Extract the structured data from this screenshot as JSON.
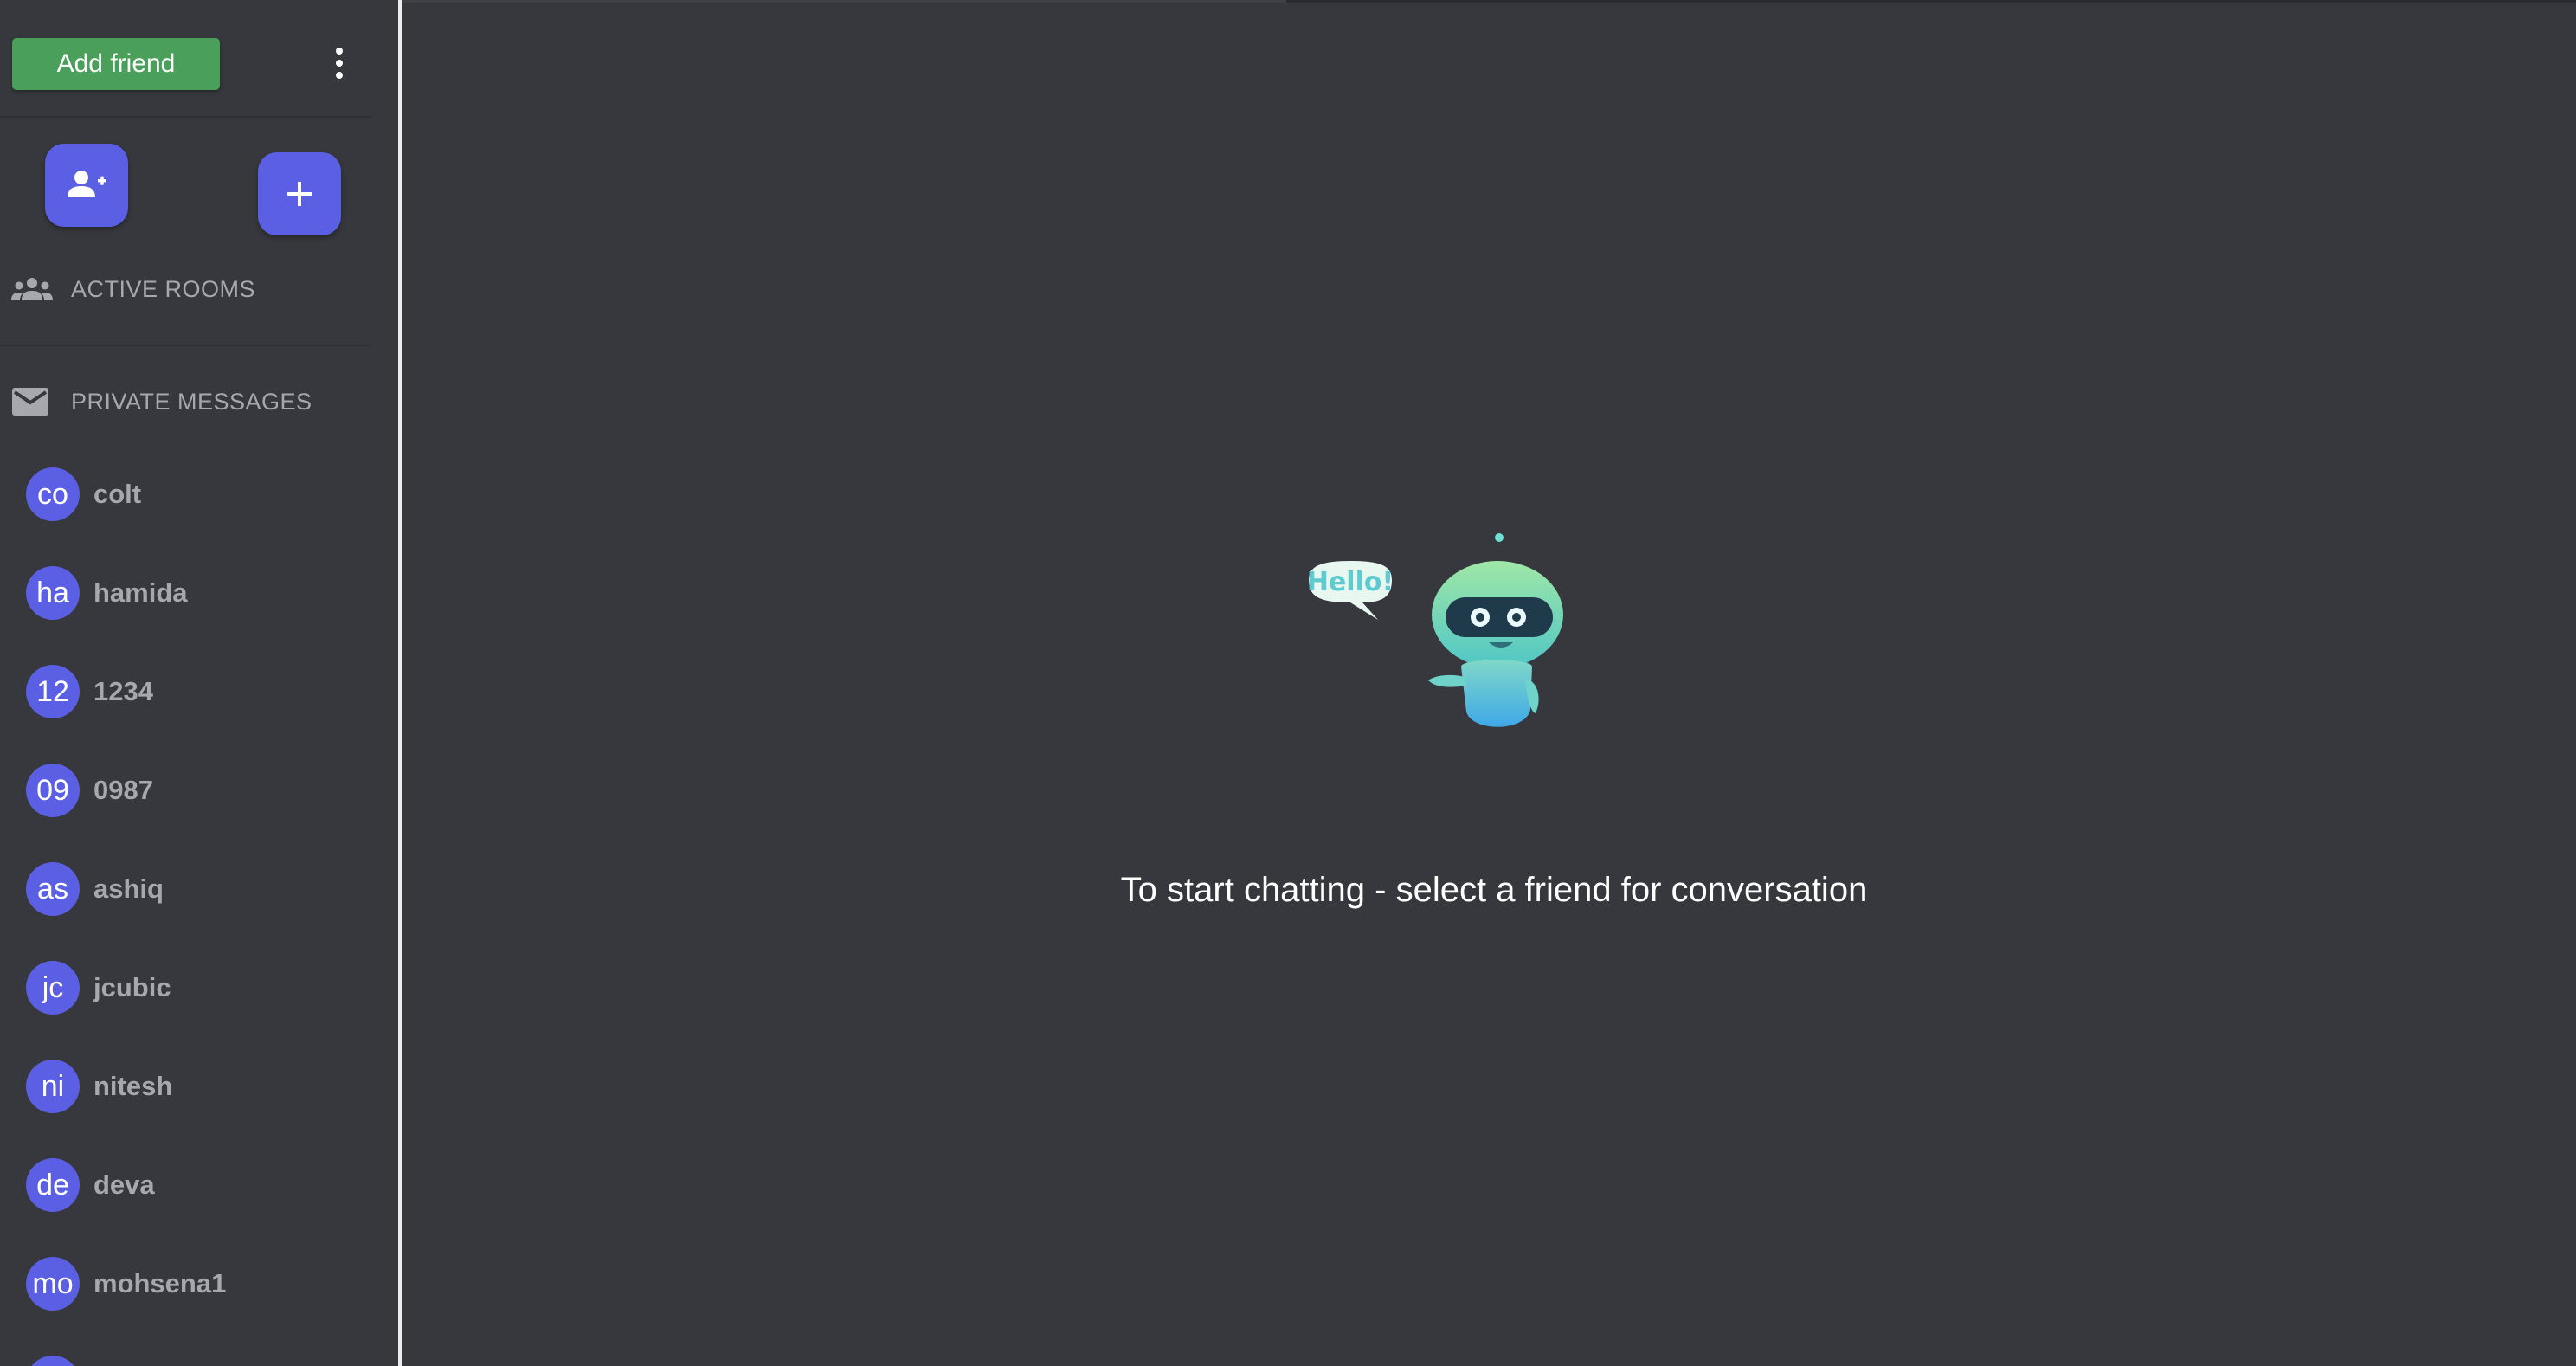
{
  "sidebar": {
    "add_friend_label": "Add friend",
    "more_icon": "more-vert-icon",
    "add_user_icon": "person-add-icon",
    "new_room_icon": "plus-icon",
    "active_rooms": {
      "icon": "group-icon",
      "label": "ACTIVE ROOMS"
    },
    "private_messages": {
      "icon": "mail-icon",
      "label": "PRIVATE MESSAGES"
    },
    "friends": [
      {
        "initials": "co",
        "name": "colt"
      },
      {
        "initials": "ha",
        "name": "hamida"
      },
      {
        "initials": "12",
        "name": "1234"
      },
      {
        "initials": "09",
        "name": "0987"
      },
      {
        "initials": "as",
        "name": "ashiq"
      },
      {
        "initials": "jc",
        "name": "jcubic"
      },
      {
        "initials": "ni",
        "name": "nitesh"
      },
      {
        "initials": "de",
        "name": "deva"
      },
      {
        "initials": "mo",
        "name": "mohsena1"
      }
    ]
  },
  "main": {
    "illustration_text": "Hello!",
    "empty_state_message": "To start chatting - select a friend for conversation"
  },
  "colors": {
    "background": "#37383d",
    "accent": "#5b5fe3",
    "add_friend_green": "#4aa05a",
    "muted_text": "#a7a8ad"
  }
}
